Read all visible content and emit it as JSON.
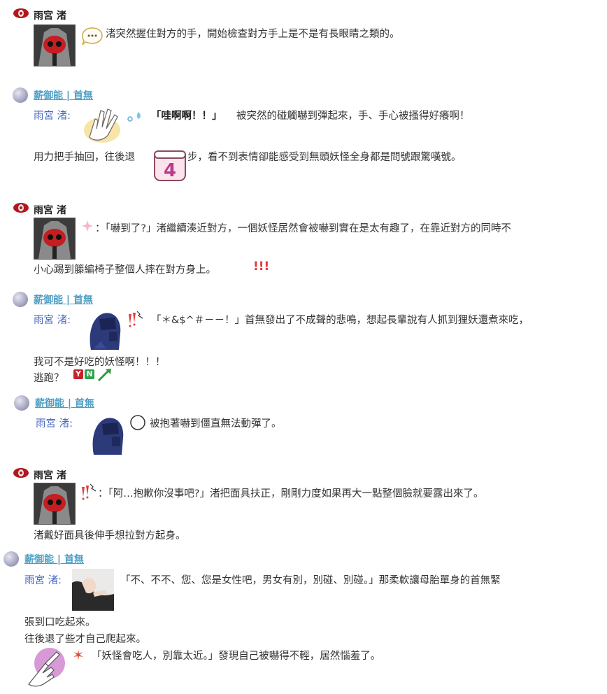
{
  "posts": [
    {
      "speaker": "雨宮 渚",
      "lines": [
        "渚突然握住對方的手，開始檢查對方手上是不是有長眼睛之類的。"
      ]
    },
    {
      "speaker": "薪御能 | 首無",
      "sub": "雨宮 渚:",
      "lines": [
        "「哇啊啊！！」",
        "被突然的碰觸嚇到彈起來，手、手心被搔得好癢啊！",
        "用力把手抽回，往後退",
        "步，看不到表情卻能感受到無頭妖怪全身都是問號跟驚嘆號。"
      ],
      "sticker": "4"
    },
    {
      "speaker": "雨宮 渚",
      "lines": [
        "：「嚇到了?」渚繼續湊近對方，一個妖怪居然會被嚇到實在是太有趣了，在靠近對方的同時不",
        "小心踢到籐編椅子整個人摔在對方身上。",
        "!!!"
      ]
    },
    {
      "speaker": "薪御能 | 首無",
      "sub": "雨宮 渚:",
      "lines": [
        "「＊&$^＃－－！」首無發出了不成聲的悲鳴，想起長輩說有人抓到狸妖還煮來吃，",
        "我可不是好吃的妖怪啊！！！",
        "逃跑？"
      ],
      "yn": [
        "Y",
        "N"
      ]
    },
    {
      "speaker": "薪御能 | 首無",
      "sub": "雨宮 渚:",
      "lines": [
        "被抱著嚇到僵直無法動彈了。"
      ]
    },
    {
      "speaker": "雨宮 渚",
      "lines": [
        "：「阿…抱歉你沒事吧?」渚把面具扶正，剛剛力度如果再大一點整個臉就要露出來了。",
        "渚戴好面具後伸手想拉對方起身。"
      ]
    },
    {
      "speaker": "薪御能 | 首無",
      "sub": "雨宮 渚:",
      "lines": [
        "「不、不不、您、您是女性吧，男女有別，別碰、別碰。」那柔軟讓母胎單身的首無緊",
        "張到口吃起來。",
        "往後退了些才自己爬起來。",
        "「妖怪會吃人，別靠太近。」發現自己被嚇得不輕，居然惱羞了。"
      ]
    }
  ],
  "colors": {
    "link": "#4d9ec4",
    "sub": "#4a69bd",
    "text": "#333333",
    "exclaim": "#e23b3b"
  },
  "icons": [
    "red-mask-icon",
    "speech-bubble-icon",
    "avatar-globe-icon",
    "wave-hand-icon",
    "sparkle-icon",
    "blue-hooded-figure-icon",
    "shock-icon",
    "thought-bubble-icon",
    "pointing-hand-icon",
    "arrow-icon"
  ]
}
